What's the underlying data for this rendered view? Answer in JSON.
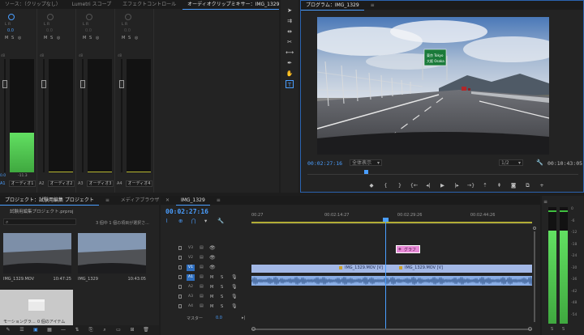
{
  "mixer": {
    "tabs": [
      {
        "label": "ソース：（クリップなし）"
      },
      {
        "label": "Lumetri スコープ"
      },
      {
        "label": "エフェクトコントロール"
      },
      {
        "label": "オーディオクリップミキサー：IMG_1329"
      }
    ],
    "knob_label": "L  R",
    "knob_value": "0.0",
    "m_label": "M",
    "s_label": "S",
    "db_label": "dB",
    "channels": [
      {
        "track": "A1",
        "name": "オーディオ1",
        "value": "-11.3"
      },
      {
        "track": "A2",
        "name": "オーディオ2",
        "value": ""
      },
      {
        "track": "A3",
        "name": "オーディオ3",
        "value": ""
      },
      {
        "track": "A4",
        "name": "オーディオ4",
        "value": ""
      }
    ],
    "ch1_level_value": "0.0",
    "ch1_meter_fraction": 0.35
  },
  "tools": {
    "icons": [
      "selection-icon",
      "track-select-icon",
      "ripple-edit-icon",
      "razor-icon",
      "slip-icon",
      "pen-icon",
      "hand-icon",
      "type-icon"
    ]
  },
  "program": {
    "tab_label": "プログラム：IMG_1329",
    "timecode": "00:02:27:16",
    "zoom": "全体表示",
    "quality": "1/2",
    "duration": "00:10:43:05",
    "playhead_fraction": 0.21,
    "sign_text_1": "東京 Tokyo",
    "sign_text_2": "大阪 Osaka"
  },
  "project": {
    "tabs": [
      {
        "label": "プロジェクト：試験用編集 プロジェクト"
      },
      {
        "label": "メディアブラウザー"
      },
      {
        "label": "CC"
      }
    ],
    "file_name": "試験用編集プロジェクト.prproj",
    "selection_info": "3 個中 1 個の項目が選択さ...",
    "items": [
      {
        "name": "IMG_1329.MOV",
        "duration": "10:47:25"
      },
      {
        "name": "IMG_1329",
        "duration": "10:43:05"
      },
      {
        "name": "モーショングラ...",
        "duration": "0 個のアイテム"
      }
    ]
  },
  "timeline": {
    "tab_label": "IMG_1329",
    "timecode": "00:02:27:16",
    "ruler": [
      {
        "label": "00:27"
      },
      {
        "label": "00:02:14:27"
      },
      {
        "label": "00:02:29:26"
      },
      {
        "label": "00:02:44:26"
      }
    ],
    "video_tracks": [
      {
        "label": "V3"
      },
      {
        "label": "V2"
      },
      {
        "label": "V1"
      }
    ],
    "audio_tracks": [
      {
        "label": "A1"
      },
      {
        "label": "A2"
      },
      {
        "label": "A3"
      },
      {
        "label": "A4"
      }
    ],
    "m_label": "M",
    "s_label": "S",
    "master_label": "マスター",
    "master_value": "0.0",
    "graphic_clip": "グラフ",
    "clip1": "IMG_1329.MOV [V]",
    "clip2": "IMG_1329.MOV [V]",
    "playhead_fraction": 0.476
  },
  "master_meter": {
    "db_marks": [
      "0",
      "-6",
      "-12",
      "-18",
      "-24",
      "-30",
      "-36",
      "-42",
      "-48",
      "-54"
    ],
    "left_label": "S",
    "right_label": "S",
    "level_fraction": 0.8
  },
  "colors": {
    "accent": "#4a9eff",
    "meter_green": "#4fd64f",
    "video_clip": "#a3b8e6",
    "audio_clip": "#8aaee6",
    "graphic_clip": "#e68ad6"
  }
}
